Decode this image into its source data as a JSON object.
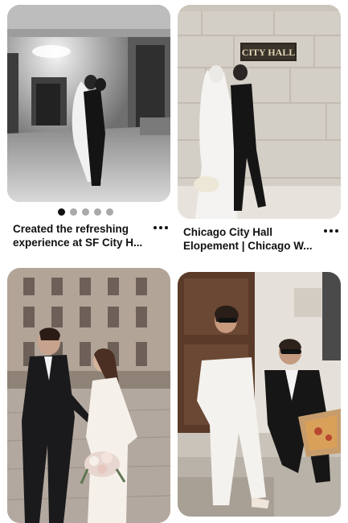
{
  "feed": {
    "pins": [
      {
        "image": "wedding-couple-hallway-bw-photo",
        "carousel_dots": 5,
        "carousel_active_index": 0,
        "title_line1": "Created the refreshing",
        "title_line2": "experience at SF City H...",
        "more_icon": "more-horizontal-icon"
      },
      {
        "image": "bride-groom-walking-city-hall-photo",
        "sign_text": "CITY HALL",
        "title_line1": "Chicago City Hall",
        "title_line2": "Elopement | Chicago W...",
        "more_icon": "more-horizontal-icon"
      },
      {
        "image": "couple-courtyard-bouquet-photo"
      },
      {
        "image": "couple-sitting-steps-pizza-photo"
      }
    ]
  }
}
